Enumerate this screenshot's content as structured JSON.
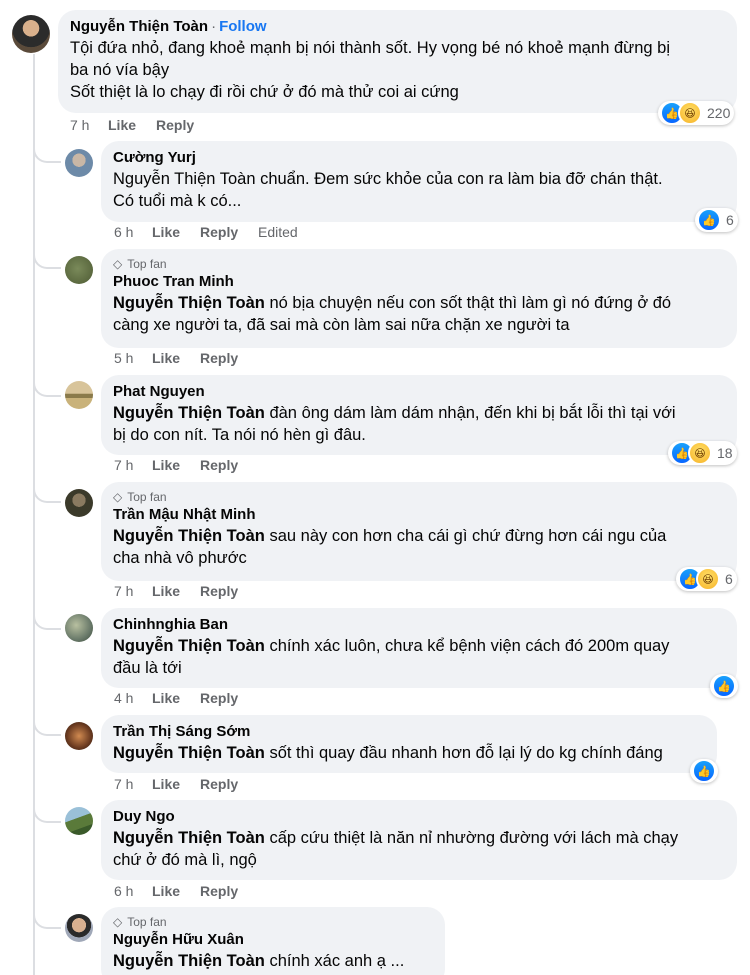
{
  "comments": [
    {
      "author": "Nguyễn Thiện Toàn",
      "follow": "Follow",
      "lines": [
        "Tội đứa nhỏ, đang khoẻ mạnh bị nói thành sốt. Hy vọng bé nó khoẻ mạnh đừng bị",
        "ba nó vía bậy",
        "Sốt thiệt là lo chạy đi rồi chứ ở đó mà thử coi ai cứng"
      ],
      "time": "7 h",
      "like": "Like",
      "reply": "Reply",
      "reaction_count": "220"
    },
    {
      "author": "Cường Yurj",
      "text_lines": [
        "Nguyễn Thiện Toàn chuẩn. Đem sức khỏe của con ra làm bia đỡ chán thật.",
        "Có tuổi mà k có..."
      ],
      "time": "6 h",
      "like": "Like",
      "reply": "Reply",
      "edited": "Edited",
      "reaction_count": "6"
    },
    {
      "badge": "Top fan",
      "author": "Phuoc Tran Minh",
      "mention": "Nguyễn Thiện Toàn",
      "text_lines": [
        " nó bịa chuyện nếu con sốt thật thì làm gì nó đứng ở đó",
        "càng xe người ta, đã sai mà còn làm sai nữa chặn xe người ta"
      ],
      "time": "5 h",
      "like": "Like",
      "reply": "Reply"
    },
    {
      "author": "Phat Nguyen",
      "mention": "Nguyễn Thiện Toàn",
      "text_lines": [
        " đàn ông dám làm dám nhận, đến khi bị bắt lỗi thì tại với",
        "bị do con nít. Ta nói nó hèn gì đâu."
      ],
      "time": "7 h",
      "like": "Like",
      "reply": "Reply",
      "reaction_count": "18"
    },
    {
      "badge": "Top fan",
      "author": "Trần Mậu Nhật Minh",
      "mention": "Nguyễn Thiện Toàn",
      "text_lines": [
        " sau này con hơn cha cái gì chứ đừng hơn cái ngu của",
        "cha nhà vô phước"
      ],
      "time": "7 h",
      "like": "Like",
      "reply": "Reply",
      "reaction_count": "6"
    },
    {
      "author": "Chinhnghia Ban",
      "mention": "Nguyễn Thiện Toàn",
      "text_lines": [
        " chính xác luôn, chưa kể bệnh viện cách đó 200m quay",
        "đầu là tới"
      ],
      "time": "4 h",
      "like": "Like",
      "reply": "Reply"
    },
    {
      "author": "Trần Thị Sáng Sớm",
      "mention": "Nguyễn Thiện Toàn",
      "text_lines": [
        " sốt thì quay đầu nhanh hơn đỗ lại lý do kg chính đáng"
      ],
      "time": "7 h",
      "like": "Like",
      "reply": "Reply"
    },
    {
      "author": "Duy Ngo",
      "mention": "Nguyễn Thiện Toàn",
      "text_lines": [
        " cấp cứu thiệt là năn nỉ nhường đường với lách mà chạy",
        "chứ ở đó mà lì, ngộ"
      ],
      "time": "6 h",
      "like": "Like",
      "reply": "Reply"
    },
    {
      "badge": "Top fan",
      "author": "Nguyễn Hữu Xuân",
      "mention": "Nguyễn Thiện Toàn",
      "text_lines": [
        " chính xác anh ạ ..."
      ]
    }
  ],
  "icons": {
    "like": "thumbs-up-icon",
    "haha": "haha-icon",
    "badge": "top-fan-diamond-icon"
  },
  "colors": {
    "link": "#1877f2",
    "bubble": "#f0f2f5",
    "meta": "#65676b"
  }
}
